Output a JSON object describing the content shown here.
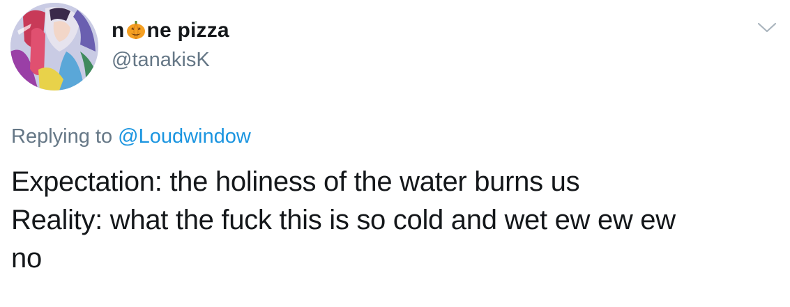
{
  "author": {
    "name_before": "n",
    "name_emoji": "pumpkin-emoji",
    "name_after": "ne pizza",
    "handle": "@tanakisK",
    "avatar": "avatar-artwork"
  },
  "menu_icon": "chevron-down-icon",
  "reply": {
    "prefix": "Replying to",
    "mention": "@Loudwindow"
  },
  "tweet": {
    "lines": [
      "Expectation: the holiness of the water burns us",
      "Reality: what the fuck this is so cold and wet ew ew ew",
      "no"
    ]
  },
  "colors": {
    "text": "#14171a",
    "secondary": "#657786",
    "link": "#1b95e0",
    "pumpkin": "#f5a023"
  }
}
